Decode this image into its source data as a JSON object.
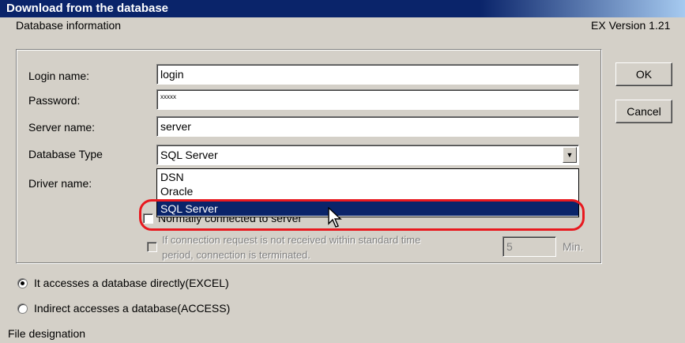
{
  "window": {
    "title": "Download from the database"
  },
  "header": {
    "section_label": "Database information",
    "version": "EX Version 1.21"
  },
  "form": {
    "login_label": "Login name:",
    "login_value": "login",
    "password_label": "Password:",
    "password_value": "xxxxx",
    "server_label": "Server name:",
    "server_value": "server",
    "dbtype_label": "Database Type",
    "dbtype_value": "SQL Server",
    "driver_label": "Driver name:"
  },
  "dropdown": {
    "options": [
      "DSN",
      "Oracle",
      "SQL Server"
    ],
    "selected_index": 2
  },
  "options": {
    "connected_label": "Normally connected to server",
    "timeout_line1": "If connection request is not received within standard time",
    "timeout_line2": "period, connection is terminated.",
    "timeout_value": "5",
    "timeout_unit": "Min."
  },
  "access_mode": {
    "direct_label": "It accesses a database directly(EXCEL)",
    "indirect_label": "Indirect accesses a database(ACCESS)",
    "selected": "direct"
  },
  "file": {
    "label": "File designation"
  },
  "buttons": {
    "ok": "OK",
    "cancel": "Cancel"
  },
  "colors": {
    "titlebar": "#0a246a",
    "face": "#d4d0c8",
    "selection": "#0a246a",
    "highlight_ring": "#e8191f"
  }
}
